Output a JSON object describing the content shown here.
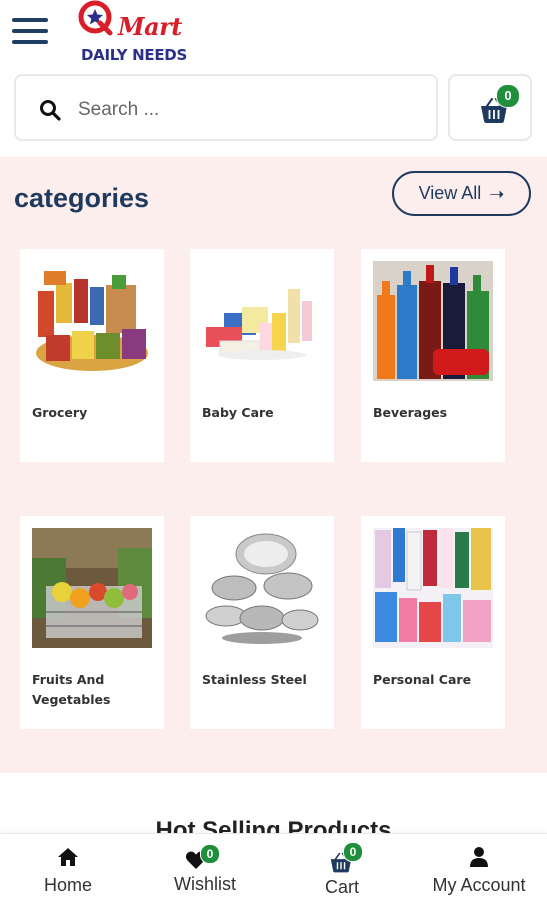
{
  "brand": {
    "logo_letter": "Q",
    "logo_word": "Mart",
    "tagline": "DAILY NEEDS",
    "colors": {
      "red": "#d81e28",
      "navy": "#2a2f8c"
    }
  },
  "header": {
    "menu_icon": "hamburger-menu-icon",
    "search": {
      "placeholder": "Search ...",
      "value": "",
      "icon": "search-icon"
    },
    "cart": {
      "icon": "shopping-basket-icon",
      "count": "0"
    }
  },
  "categories": {
    "title": "categories",
    "view_all": "View All",
    "view_all_icon": "arrow-right-icon",
    "items": [
      {
        "label": "Grocery",
        "image": "grocery-image"
      },
      {
        "label": "Baby Care",
        "image": "baby-care-image"
      },
      {
        "label": "Beverages",
        "image": "beverages-image"
      },
      {
        "label": "Fruits And Vegetables",
        "image": "fruits-vegetables-image"
      },
      {
        "label": "Stainless Steel",
        "image": "stainless-steel-image"
      },
      {
        "label": "Personal Care",
        "image": "personal-care-image"
      }
    ]
  },
  "hot_selling": {
    "title": "Hot Selling Products"
  },
  "bottom_nav": {
    "items": [
      {
        "label": "Home",
        "icon": "home-icon"
      },
      {
        "label": "Wishlist",
        "icon": "heart-icon",
        "badge": "0"
      },
      {
        "label": "Cart",
        "icon": "shopping-basket-icon",
        "badge": "0"
      },
      {
        "label": "My Account",
        "icon": "user-icon"
      }
    ]
  },
  "colors": {
    "primary": "#1e3a5f",
    "badge_green": "#1f8f3c",
    "section_bg": "#fdeeee"
  }
}
